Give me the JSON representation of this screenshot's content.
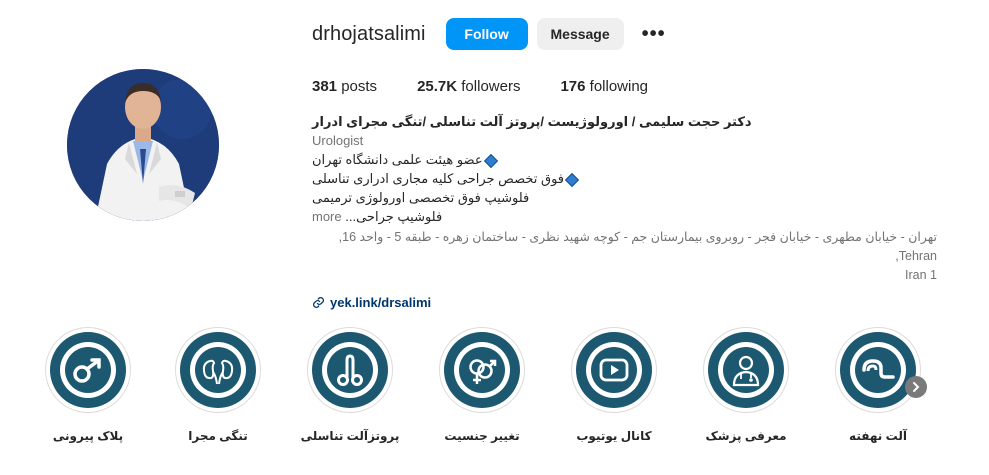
{
  "profile": {
    "username": "drhojatsalimi",
    "follow_label": "Follow",
    "message_label": "Message",
    "more_label": "•••"
  },
  "stats": {
    "posts_count": "381",
    "posts_label": "posts",
    "followers_count": "25.7K",
    "followers_label": "followers",
    "following_count": "176",
    "following_label": "following"
  },
  "bio": {
    "name": "دکتر حجت سلیمی / اورولوژیست /پروتز آلت تناسلی /تنگی مجرای ادرار",
    "category": "Urologist",
    "line1": "عضو هیئت علمی دانشگاه تهران",
    "line2": "فوق تخصص جراحی کلیه مجاری ادراری تناسلی",
    "line3": "فلوشیپ فوق تخصصی اورولوژی ترمیمی",
    "line4": "فلوشیپ جراحی...",
    "more_label": "more",
    "address_line1": "تهران - خیابان مطهری - خیابان فجر - روبروی بیمارستان جم - کوچه شهید نظری - ساختمان زهره - طبقه 5 - واحد 16, Tehran,",
    "address_line2": "Iran 1",
    "link": "yek.link/drsalimi"
  },
  "highlights": [
    {
      "label": "پلاک پیرونی",
      "icon": "peyronie-icon"
    },
    {
      "label": "تنگی مجرا",
      "icon": "kidneys-icon"
    },
    {
      "label": "پروتزآلت تناسلی",
      "icon": "prosthesis-icon"
    },
    {
      "label": "تغییر جنسیت",
      "icon": "gender-symbols-icon"
    },
    {
      "label": "کانال یوتیوب",
      "icon": "youtube-play-icon"
    },
    {
      "label": "معرفی پزشک",
      "icon": "doctor-icon"
    },
    {
      "label": "آلت نهفته",
      "icon": "hidden-penis-icon"
    }
  ],
  "colors": {
    "follow_button": "#0095f6",
    "highlight_ring": "#1d5871",
    "link": "#00376b"
  }
}
